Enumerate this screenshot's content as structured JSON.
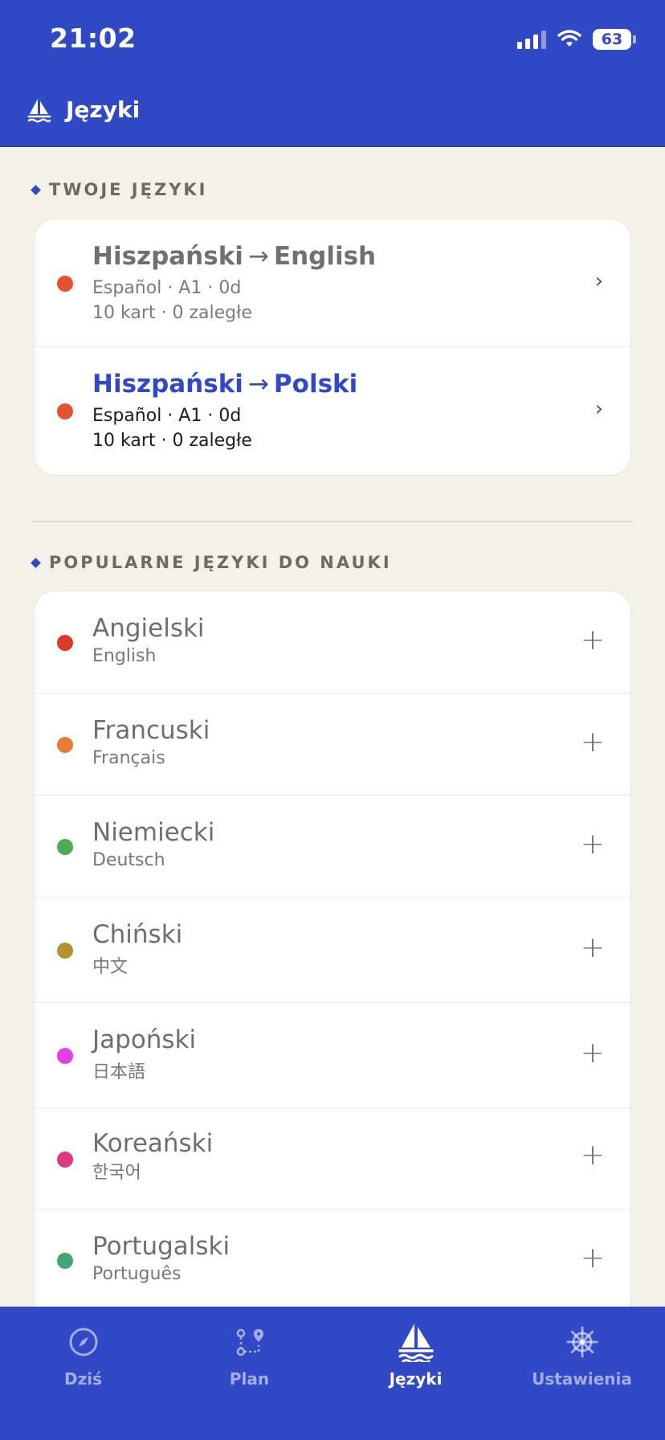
{
  "status_bar": {
    "time": "21:02",
    "battery": "63"
  },
  "header": {
    "title": "Języki",
    "icon": "sailboat-icon"
  },
  "my_languages": {
    "section_label": "TWOJE JĘZYKI",
    "items": [
      {
        "source": "Hiszpański",
        "arrow": "→",
        "target": "English",
        "meta": "Español · A1 · 0d",
        "stats": "10 kart · 0 zaległe",
        "dot_color": "#e5532d",
        "active": false
      },
      {
        "source": "Hiszpański",
        "arrow": "→",
        "target": "Polski",
        "meta": "Español · A1 · 0d",
        "stats": "10 kart · 0 zaległe",
        "dot_color": "#e5532d",
        "active": true
      }
    ]
  },
  "popular": {
    "section_label": "POPULARNE JĘZYKI DO NAUKI",
    "items": [
      {
        "name": "Angielski",
        "native": "English",
        "dot_color": "#d93a2b"
      },
      {
        "name": "Francuski",
        "native": "Français",
        "dot_color": "#e97a35"
      },
      {
        "name": "Niemiecki",
        "native": "Deutsch",
        "dot_color": "#4cab55"
      },
      {
        "name": "Chiński",
        "native": "中文",
        "dot_color": "#b3922f"
      },
      {
        "name": "Japoński",
        "native": "日本語",
        "dot_color": "#e43ee8"
      },
      {
        "name": "Koreański",
        "native": "한국어",
        "dot_color": "#e03a7c"
      },
      {
        "name": "Portugalski",
        "native": "Português",
        "dot_color": "#43a57a"
      }
    ]
  },
  "tabs": [
    {
      "label": "Dziś",
      "icon": "compass-icon",
      "active": false
    },
    {
      "label": "Plan",
      "icon": "route-icon",
      "active": false
    },
    {
      "label": "Języki",
      "icon": "sailboat-icon",
      "active": true
    },
    {
      "label": "Ustawienia",
      "icon": "ships-wheel-icon",
      "active": false
    }
  ],
  "colors": {
    "brand": "#3149c4",
    "background": "#f3f1e8"
  }
}
